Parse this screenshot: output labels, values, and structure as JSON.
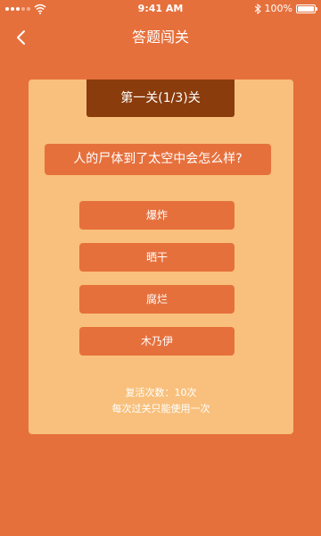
{
  "status_bar": {
    "time": "9:41 AM",
    "battery": "100%"
  },
  "nav": {
    "title": "答题闯关",
    "back_icon": "chevron-left-icon"
  },
  "quiz": {
    "level_label": "第一关(1/3)关",
    "question": "人的尸体到了太空中会怎么样?",
    "options": [
      "爆炸",
      "晒干",
      "腐烂",
      "木乃伊"
    ],
    "revive_count": "复活次数：10次",
    "revive_note": "每次过关只能使用一次"
  },
  "colors": {
    "background": "#E6703C",
    "card": "#F8C07C",
    "banner": "#8A3C0C",
    "button": "#E6703C",
    "text": "#FFFFFF"
  }
}
